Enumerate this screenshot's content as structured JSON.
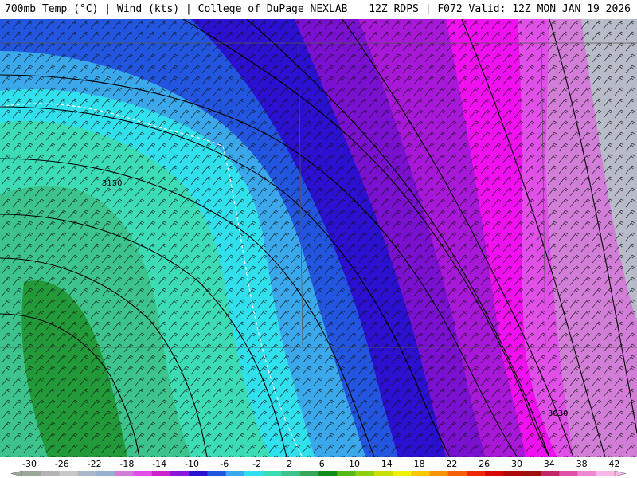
{
  "header": {
    "left": "700mb Temp (°C) | Wind (kts) | College of DuPage NEXLAB",
    "right": "12Z RDPS | F072 Valid: 12Z MON JAN 19 2026"
  },
  "map": {
    "height_labels": [
      "3150",
      "3030"
    ]
  },
  "colorbar": {
    "tick_labels": [
      "-30",
      "-26",
      "-22",
      "-18",
      "-14",
      "-10",
      "-6",
      "-2",
      "2",
      "6",
      "10",
      "14",
      "18",
      "22",
      "26",
      "30",
      "34",
      "38",
      "42"
    ],
    "colors": [
      "#9aa89a",
      "#b4b4b4",
      "#c8c8c8",
      "#a8b8c8",
      "#98b0d0",
      "#d27ed8",
      "#e04fe8",
      "#cc22cc",
      "#8a18d8",
      "#2a10d0",
      "#2256e0",
      "#3aa8ea",
      "#30e0ec",
      "#3cdcb4",
      "#3cc48c",
      "#38a858",
      "#148c1c",
      "#58b818",
      "#8cd010",
      "#c8e008",
      "#f0f008",
      "#f8c808",
      "#f89408",
      "#f86008",
      "#f02808",
      "#d80808",
      "#b00808",
      "#a01010",
      "#c02868",
      "#e050a8",
      "#f088d0",
      "#f8b8e8"
    ]
  }
}
